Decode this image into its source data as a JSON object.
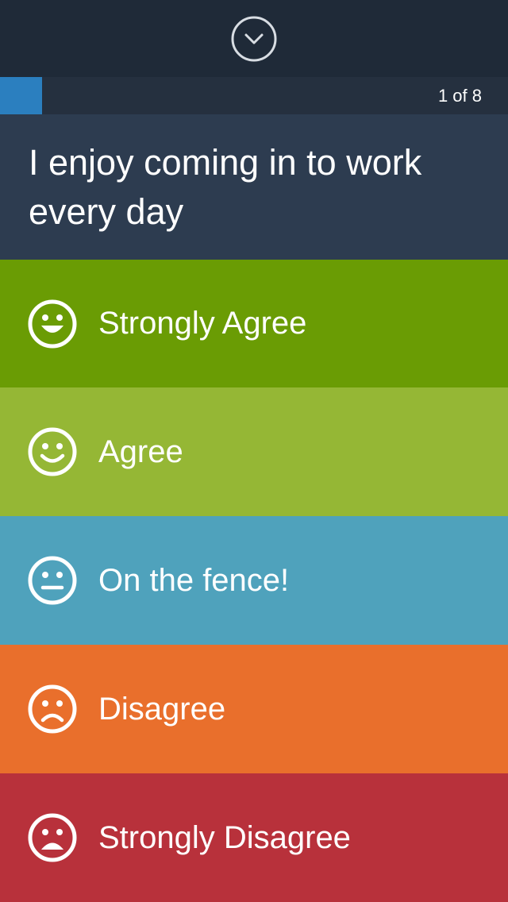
{
  "header": {
    "collapse_icon": "chevron-down-circle-icon"
  },
  "progress": {
    "current": 1,
    "total": 8,
    "label": "1 of 8",
    "fraction": 0.083
  },
  "question": {
    "text": "I enjoy coming in to work every day"
  },
  "options": [
    {
      "label": "Strongly Agree",
      "icon": "big-smile-icon",
      "color": "#6a9c04"
    },
    {
      "label": "Agree",
      "icon": "smile-icon",
      "color": "#95b735"
    },
    {
      "label": "On the fence!",
      "icon": "neutral-face-icon",
      "color": "#4fa2bc"
    },
    {
      "label": "Disagree",
      "icon": "frown-icon",
      "color": "#e96f2c"
    },
    {
      "label": "Strongly Disagree",
      "icon": "big-frown-icon",
      "color": "#b8313b"
    }
  ]
}
